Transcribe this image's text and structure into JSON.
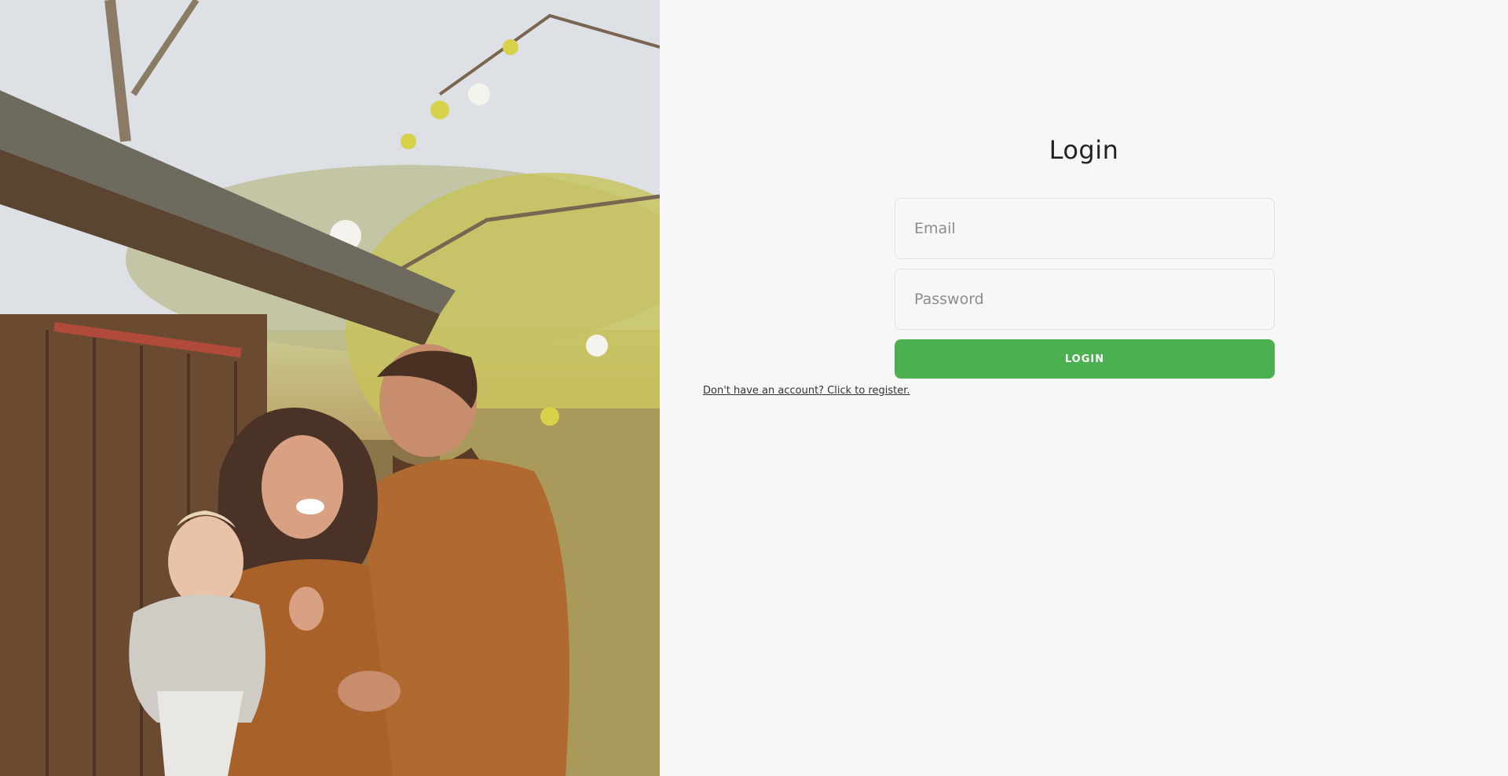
{
  "hero_image": {
    "description_icon": "family-photo",
    "accent_colors": {
      "shirt": "#b36a2e",
      "wood": "#6b4a30",
      "sky": "#dfe2e6",
      "leaves": "#c9c448"
    }
  },
  "login": {
    "title": "Login",
    "email_placeholder": "Email",
    "email_value": "",
    "password_placeholder": "Password",
    "password_value": "",
    "button_label": "LOGIN",
    "register_link": "Don't have an account? Click to register."
  },
  "colors": {
    "background": "#f7f7f7",
    "primary": "#4caf50",
    "text": "#222222"
  }
}
